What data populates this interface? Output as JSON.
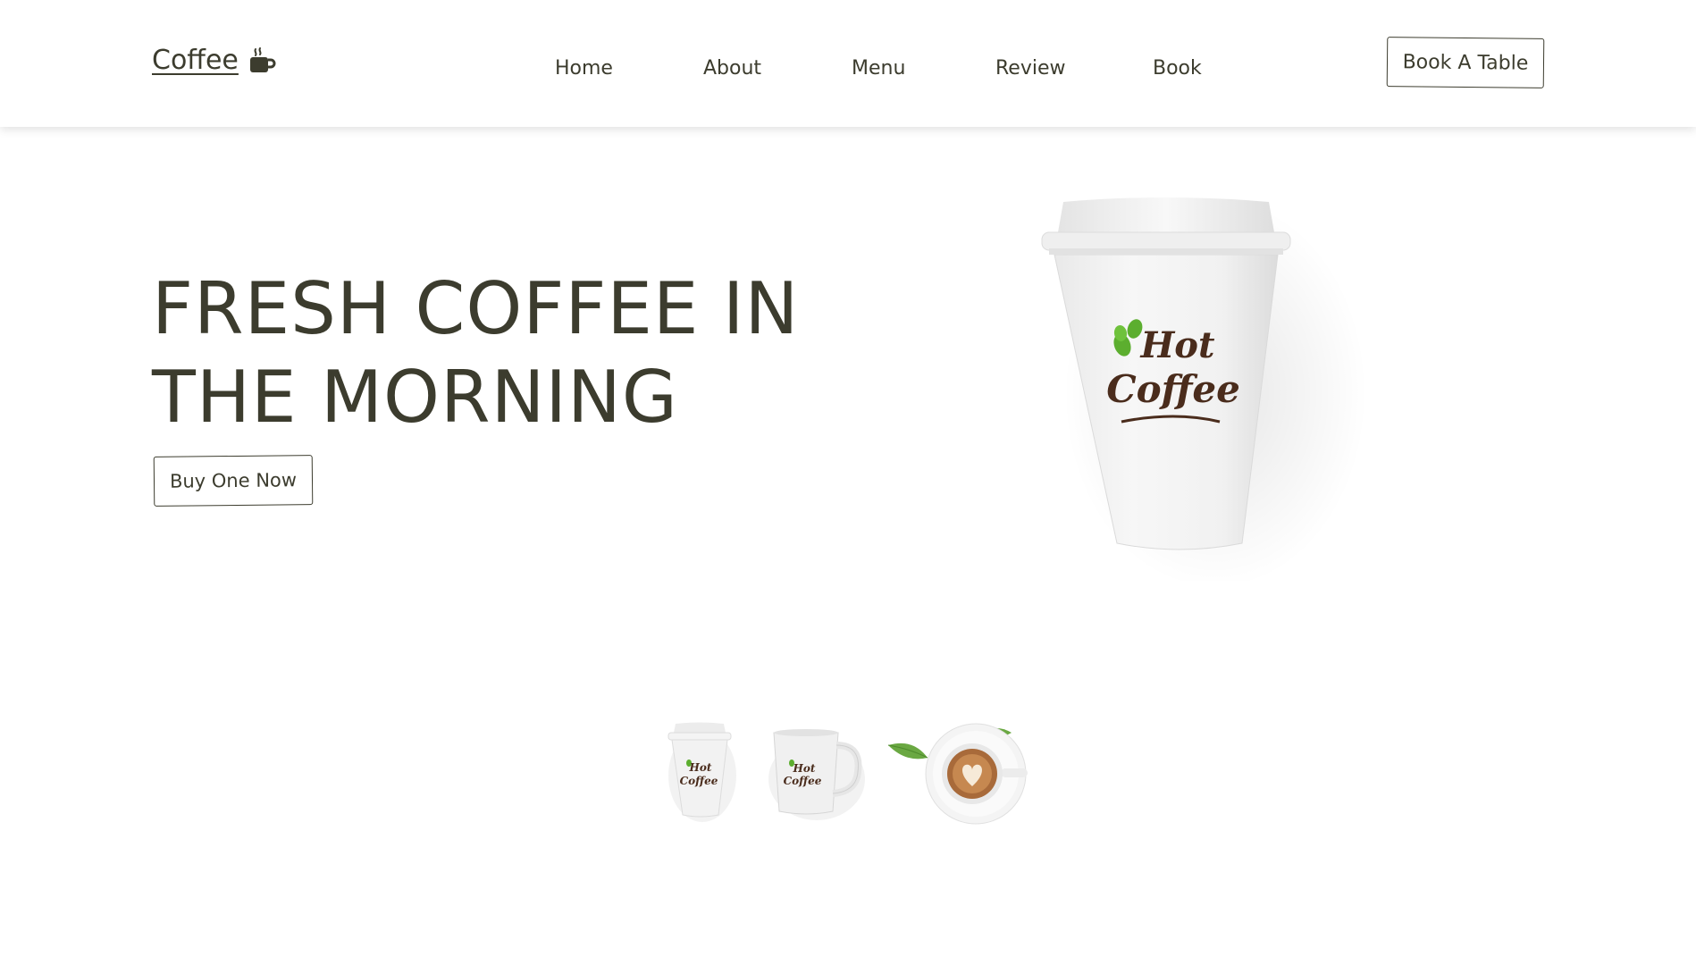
{
  "header": {
    "logo_text": "Coffee",
    "logo_icon": "coffee-mug-icon",
    "nav": [
      "Home",
      "About",
      "Menu",
      "Review",
      "Book"
    ],
    "cta_label": "Book A Table"
  },
  "hero": {
    "title_line1": "FRESH COFFEE IN",
    "title_line2": "THE MORNING",
    "button_label": "Buy One Now",
    "cup_brand_line1": "Hot",
    "cup_brand_line2": "Coffee"
  },
  "thumbnails": [
    {
      "name": "paper-cup",
      "brand": "Hot Coffee"
    },
    {
      "name": "mug",
      "brand": "Hot Coffee"
    },
    {
      "name": "latte-cup"
    }
  ],
  "colors": {
    "text": "#3c3c2e",
    "accent_green": "#5cae2f",
    "brand_brown": "#4a2c1c"
  }
}
